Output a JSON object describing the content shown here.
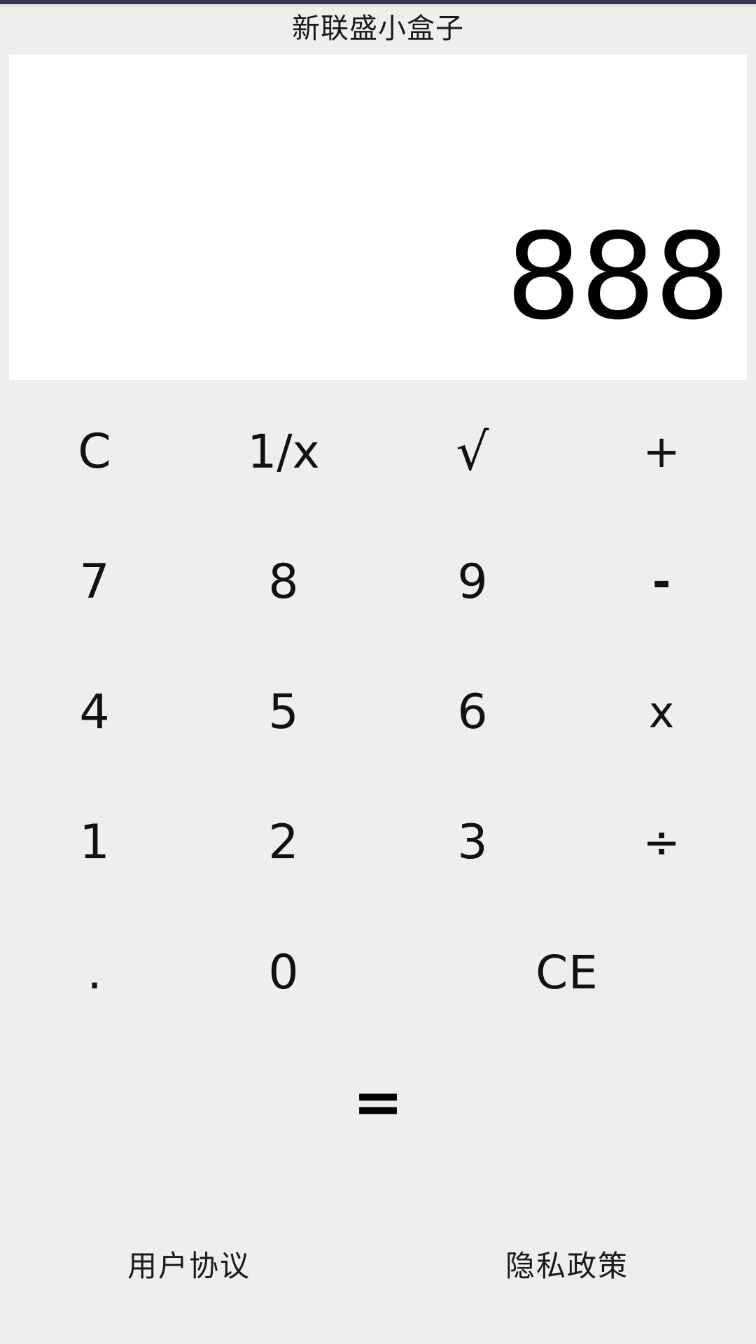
{
  "app": {
    "title": "新联盛小盒子",
    "background_color": "#eeeeee",
    "status_bar_color": "#3b3551"
  },
  "display": {
    "value": "888",
    "background_color": "#ffffff",
    "text_color": "#000000"
  },
  "keypad": {
    "rows": [
      [
        {
          "label": "C",
          "name": "clear"
        },
        {
          "label": "1/x",
          "name": "reciprocal"
        },
        {
          "label": "√",
          "name": "square-root"
        },
        {
          "label": "+",
          "name": "add"
        }
      ],
      [
        {
          "label": "7",
          "name": "seven"
        },
        {
          "label": "8",
          "name": "eight"
        },
        {
          "label": "9",
          "name": "nine"
        },
        {
          "label": "-",
          "name": "subtract"
        }
      ],
      [
        {
          "label": "4",
          "name": "four"
        },
        {
          "label": "5",
          "name": "five"
        },
        {
          "label": "6",
          "name": "six"
        },
        {
          "label": "x",
          "name": "multiply"
        }
      ],
      [
        {
          "label": "1",
          "name": "one"
        },
        {
          "label": "2",
          "name": "two"
        },
        {
          "label": "3",
          "name": "three"
        },
        {
          "label": "÷",
          "name": "divide"
        }
      ],
      [
        {
          "label": ".",
          "name": "decimal-point"
        },
        {
          "label": "0",
          "name": "zero"
        },
        {
          "label": "CE",
          "name": "clear-entry"
        }
      ]
    ],
    "equals_label": "="
  },
  "footer": {
    "user_agreement_label": "用户协议",
    "privacy_policy_label": "隐私政策"
  }
}
